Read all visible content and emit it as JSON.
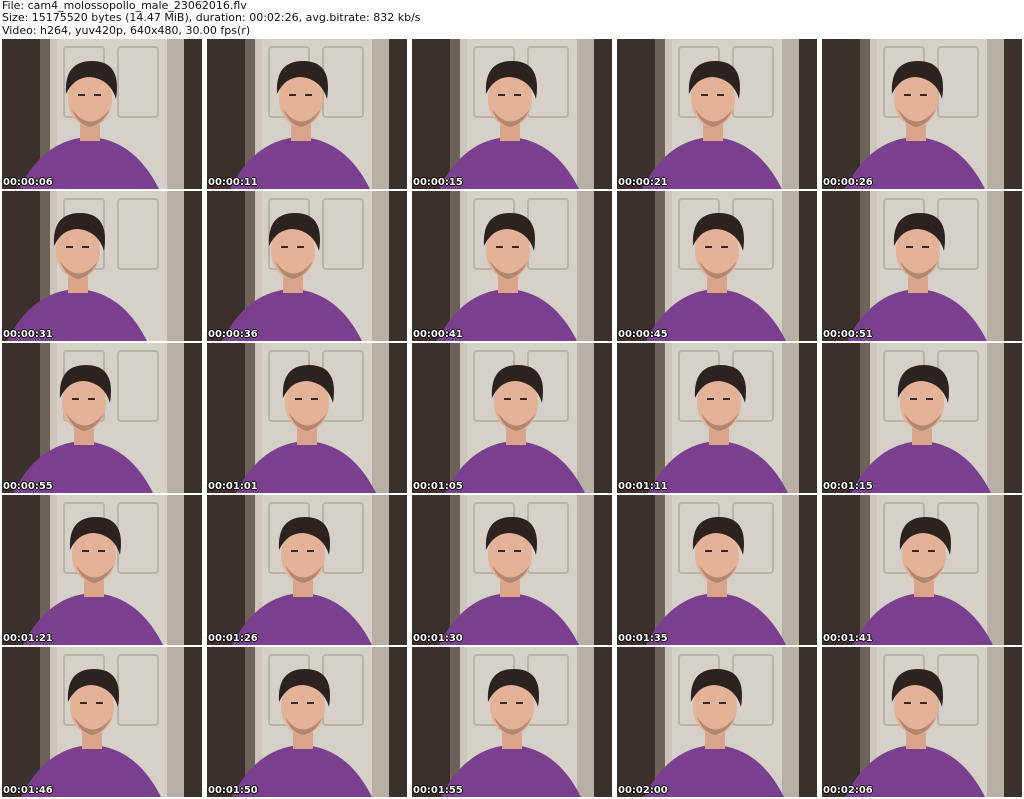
{
  "header": {
    "line1": "File: cam4_molossopollo_male_23062016.flv",
    "line2": "Size: 15175520 bytes (14.47 MiB), duration: 00:02:26, avg.bitrate: 832 kb/s",
    "line3": "Video: h264, yuv420p, 640x480, 30.00 fps(r)"
  },
  "thumbnails": [
    {
      "timestamp": "00:00:06"
    },
    {
      "timestamp": "00:00:11"
    },
    {
      "timestamp": "00:00:15"
    },
    {
      "timestamp": "00:00:21"
    },
    {
      "timestamp": "00:00:26"
    },
    {
      "timestamp": "00:00:31"
    },
    {
      "timestamp": "00:00:36"
    },
    {
      "timestamp": "00:00:41"
    },
    {
      "timestamp": "00:00:45"
    },
    {
      "timestamp": "00:00:51"
    },
    {
      "timestamp": "00:00:55"
    },
    {
      "timestamp": "00:01:01"
    },
    {
      "timestamp": "00:01:05"
    },
    {
      "timestamp": "00:01:11"
    },
    {
      "timestamp": "00:01:15"
    },
    {
      "timestamp": "00:01:21"
    },
    {
      "timestamp": "00:01:26"
    },
    {
      "timestamp": "00:01:30"
    },
    {
      "timestamp": "00:01:35"
    },
    {
      "timestamp": "00:01:41"
    },
    {
      "timestamp": "00:01:46"
    },
    {
      "timestamp": "00:01:50"
    },
    {
      "timestamp": "00:01:55"
    },
    {
      "timestamp": "00:02:00"
    },
    {
      "timestamp": "00:02:06"
    }
  ]
}
